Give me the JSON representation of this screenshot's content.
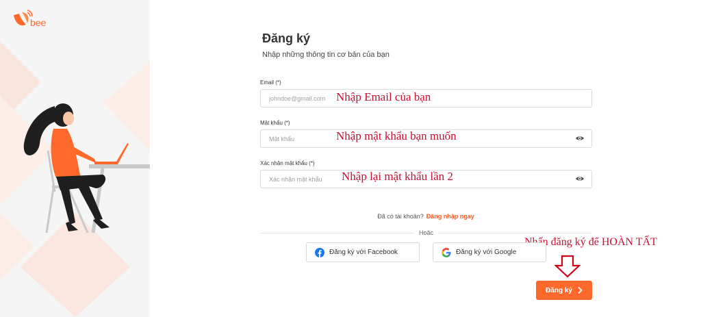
{
  "brand": {
    "logo_text": "bee",
    "accent": "#ff6a2c",
    "annotation_color": "#c8102e"
  },
  "form": {
    "title": "Đăng ký",
    "subtitle": "Nhập những thông tin cơ bản của bạn",
    "email": {
      "label": "Email (*)",
      "placeholder": "johndoe@gmail.com",
      "value": ""
    },
    "password": {
      "label": "Mật khẩu (*)",
      "placeholder": "Mật khẩu",
      "value": "",
      "icon": "eye-icon"
    },
    "confirm_password": {
      "label": "Xác nhận mật khẩu (*)",
      "placeholder": "Xác nhận mật khẩu",
      "value": "",
      "icon": "eye-icon"
    },
    "login_question": "Đã có tài khoản?",
    "login_link": "Đăng nhập ngay",
    "or_text": "Hoặc",
    "facebook_button": {
      "label": "Đăng ký với Facebook",
      "icon": "facebook-icon"
    },
    "google_button": {
      "label": "Đăng ký với Google",
      "icon": "google-icon"
    },
    "submit_button": {
      "label": "Đăng ký",
      "icon": "chevron-right-icon"
    }
  },
  "annotations": {
    "email_hint": "Nhập Email của bạn",
    "password_hint": "Nhập mật khẩu bạn muốn",
    "confirm_hint": "Nhập lại mật khẩu lần 2",
    "submit_hint": "Nhấn đăng ký để HOÀN TẤT",
    "arrow_icon": "arrow-down-icon"
  }
}
